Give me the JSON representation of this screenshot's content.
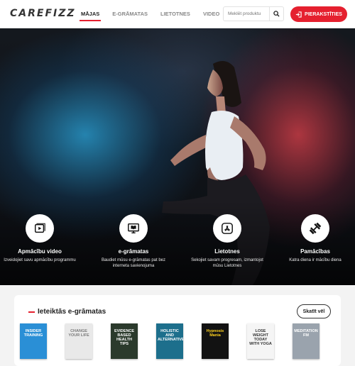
{
  "header": {
    "logo": "CAREFIZZ",
    "nav": [
      {
        "label": "MĀJAS",
        "active": true
      },
      {
        "label": "E-GRĀMATAS",
        "active": false
      },
      {
        "label": "LIETOTNES",
        "active": false
      },
      {
        "label": "VIDEO",
        "active": false
      }
    ],
    "search_placeholder": "Meklēt produktu",
    "signin_label": "PIERAKSTĪTIES",
    "accent_color": "#e5202f"
  },
  "features": [
    {
      "icon": "video-play-icon",
      "title": "Apmācību video",
      "desc": "Izveidojiet savu apmācību programmu"
    },
    {
      "icon": "ebook-icon",
      "title": "e-grāmatas",
      "desc": "Baudiet mūsu e-grāmatas pat bez interneta savienojuma"
    },
    {
      "icon": "app-store-icon",
      "title": "Lietotnes",
      "desc": "Sekojiet savam progresam, izmantojot mūsu Lietotnes"
    },
    {
      "icon": "dumbbell-icon",
      "title": "Pamācības",
      "desc": "Katra diena ir mācību diena"
    }
  ],
  "ebooks": {
    "title": "Ieteiktās e-grāmatas",
    "see_more": "Skatīt vēl",
    "books": [
      {
        "title": "INSIDER TRAINING",
        "bg": "#2a8fd6",
        "fg": "#ffffff"
      },
      {
        "title": "CHANGE YOUR LIFE",
        "bg": "#e9e9e9",
        "fg": "#7a7a7a"
      },
      {
        "title": "EVIDENCE BASED HEALTH TIPS",
        "bg": "#2b3a2c",
        "fg": "#ffffff"
      },
      {
        "title": "HOLISTIC AND ALTERNATIVE",
        "bg": "#1d6f8c",
        "fg": "#ffffff"
      },
      {
        "title": "Hypnosis Mania",
        "bg": "#121212",
        "fg": "#ffd21f"
      },
      {
        "title": "LOSE WEIGHT TODAY WITH YOGA",
        "bg": "#f5f5f5",
        "fg": "#333333"
      },
      {
        "title": "MEDITATION FM",
        "bg": "#9aa3ad",
        "fg": "#ffffff"
      }
    ]
  }
}
